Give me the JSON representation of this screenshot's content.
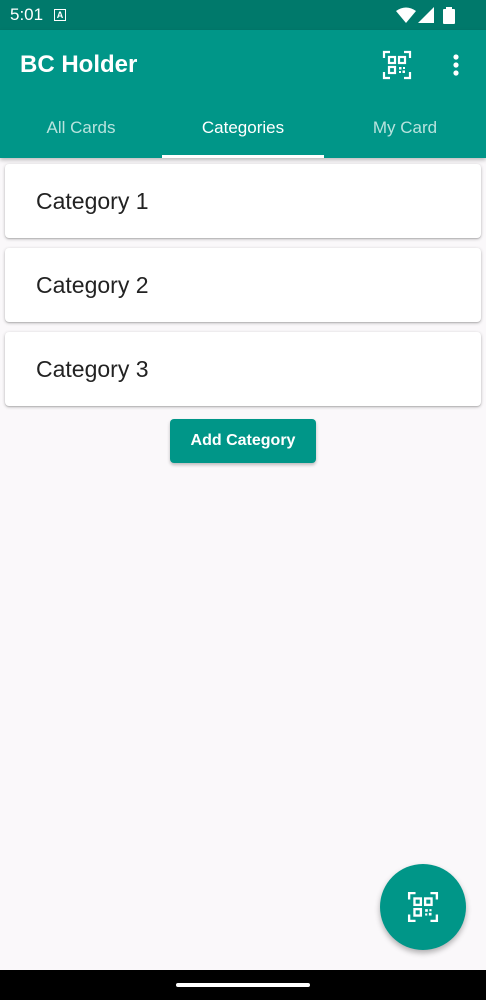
{
  "status_bar": {
    "time": "5:01",
    "notification_letter": "A"
  },
  "app_bar": {
    "title": "BC Holder",
    "color": "#009688",
    "dark_color": "#00796b"
  },
  "tabs": [
    {
      "label": "All Cards",
      "active": false
    },
    {
      "label": "Categories",
      "active": true
    },
    {
      "label": "My Card",
      "active": false
    }
  ],
  "categories": [
    {
      "label": "Category 1"
    },
    {
      "label": "Category 2"
    },
    {
      "label": "Category 3"
    }
  ],
  "add_button": {
    "label": "Add Category"
  },
  "icons": {
    "toolbar_scan": "qr-scan-icon",
    "overflow": "more-vert-icon",
    "fab": "qr-scan-icon"
  }
}
